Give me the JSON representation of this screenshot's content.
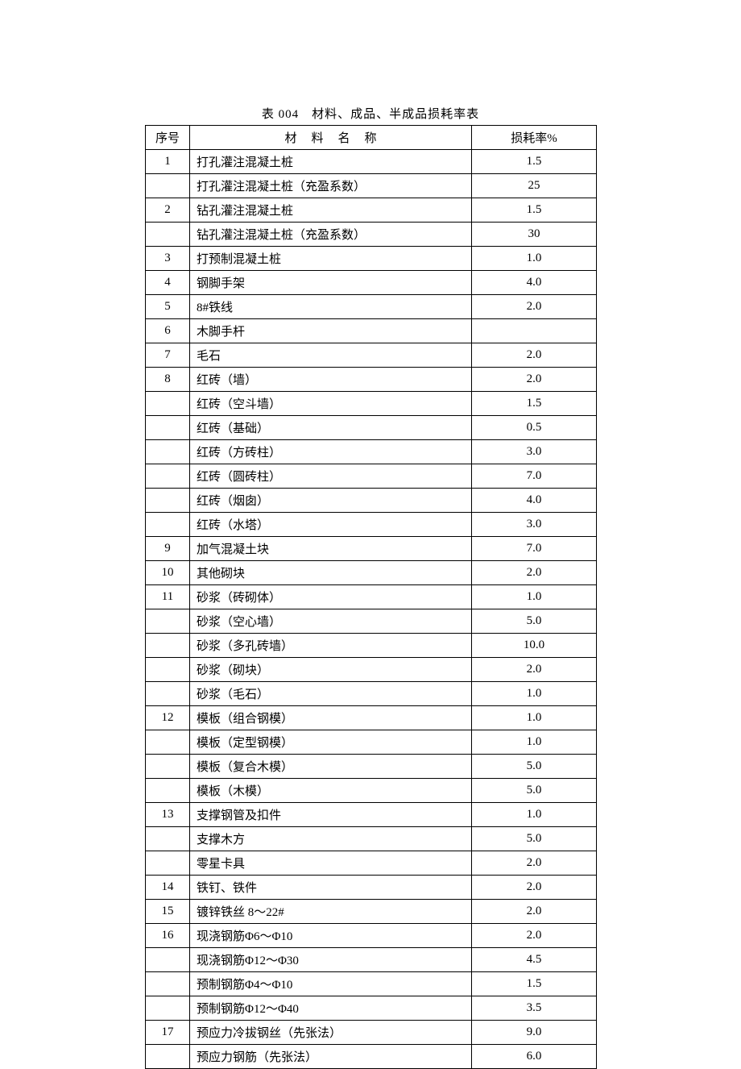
{
  "title": "表 004　材料、成品、半成品损耗率表",
  "headers": {
    "seq": "序号",
    "name": "材料名称",
    "rate": "损耗率%"
  },
  "rows": [
    {
      "seq": "1",
      "name": "打孔灌注混凝土桩",
      "rate": "1.5"
    },
    {
      "seq": "",
      "name": "打孔灌注混凝土桩（充盈系数）",
      "rate": "25"
    },
    {
      "seq": "2",
      "name": "钻孔灌注混凝土桩",
      "rate": "1.5"
    },
    {
      "seq": "",
      "name": "钻孔灌注混凝土桩（充盈系数）",
      "rate": "30"
    },
    {
      "seq": "3",
      "name": "打预制混凝土桩",
      "rate": "1.0"
    },
    {
      "seq": "4",
      "name": "钢脚手架",
      "rate": "4.0"
    },
    {
      "seq": "5",
      "name": "8#铁线",
      "rate": "2.0"
    },
    {
      "seq": "6",
      "name": "木脚手杆",
      "rate": ""
    },
    {
      "seq": "7",
      "name": "毛石",
      "rate": "2.0"
    },
    {
      "seq": "8",
      "name": "红砖（墙）",
      "rate": "2.0"
    },
    {
      "seq": "",
      "name": "红砖（空斗墙）",
      "rate": "1.5"
    },
    {
      "seq": "",
      "name": "红砖（基础）",
      "rate": "0.5"
    },
    {
      "seq": "",
      "name": "红砖（方砖柱）",
      "rate": "3.0"
    },
    {
      "seq": "",
      "name": "红砖（圆砖柱）",
      "rate": "7.0"
    },
    {
      "seq": "",
      "name": "红砖（烟囱）",
      "rate": "4.0"
    },
    {
      "seq": "",
      "name": "红砖（水塔）",
      "rate": "3.0"
    },
    {
      "seq": "9",
      "name": "加气混凝土块",
      "rate": "7.0"
    },
    {
      "seq": "10",
      "name": "其他砌块",
      "rate": "2.0"
    },
    {
      "seq": "11",
      "name": "砂浆（砖砌体）",
      "rate": "1.0"
    },
    {
      "seq": "",
      "name": "砂浆（空心墙）",
      "rate": "5.0"
    },
    {
      "seq": "",
      "name": "砂浆（多孔砖墙）",
      "rate": "10.0"
    },
    {
      "seq": "",
      "name": "砂浆（砌块）",
      "rate": "2.0"
    },
    {
      "seq": "",
      "name": "砂浆（毛石）",
      "rate": "1.0"
    },
    {
      "seq": "12",
      "name": "模板（组合钢模）",
      "rate": "1.0"
    },
    {
      "seq": "",
      "name": "模板（定型钢模）",
      "rate": "1.0"
    },
    {
      "seq": "",
      "name": "模板（复合木模）",
      "rate": "5.0"
    },
    {
      "seq": "",
      "name": "模板（木模）",
      "rate": "5.0"
    },
    {
      "seq": "13",
      "name": "支撑钢管及扣件",
      "rate": "1.0"
    },
    {
      "seq": "",
      "name": "支撑木方",
      "rate": "5.0"
    },
    {
      "seq": "",
      "name": "零星卡具",
      "rate": "2.0"
    },
    {
      "seq": "14",
      "name": "铁钉、铁件",
      "rate": "2.0"
    },
    {
      "seq": "15",
      "name": "镀锌铁丝 8～22#",
      "rate": "2.0"
    },
    {
      "seq": "16",
      "name": "现浇钢筋Φ6～Φ10",
      "rate": "2.0"
    },
    {
      "seq": "",
      "name": "现浇钢筋Φ12～Φ30",
      "rate": "4.5"
    },
    {
      "seq": "",
      "name": "预制钢筋Φ4～Φ10",
      "rate": "1.5"
    },
    {
      "seq": "",
      "name": "预制钢筋Φ12～Φ40",
      "rate": "3.5"
    },
    {
      "seq": "17",
      "name": "预应力冷拔钢丝（先张法）",
      "rate": "9.0"
    },
    {
      "seq": "",
      "name": "预应力钢筋（先张法）",
      "rate": "6.0"
    }
  ]
}
